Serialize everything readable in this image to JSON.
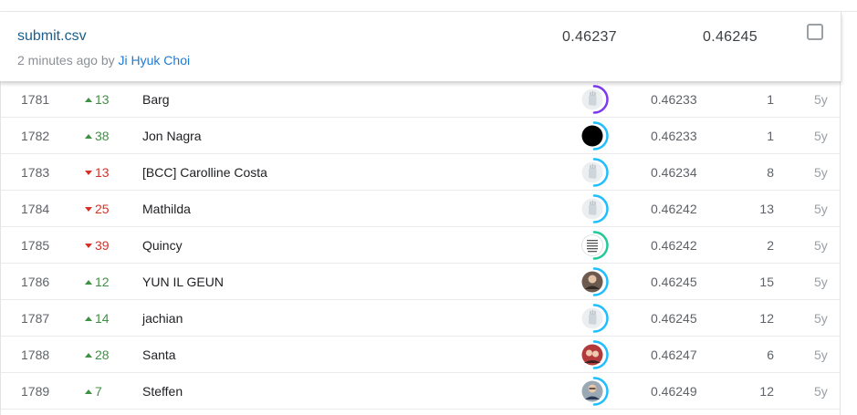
{
  "submission": {
    "file_name": "submit.csv",
    "time_ago": "2 minutes ago by ",
    "user": "Ji Hyuk Choi",
    "private_score": "0.46237",
    "public_score": "0.46245",
    "selected": false
  },
  "leaderboard": {
    "rows": [
      {
        "rank": "1781",
        "direction": "up",
        "change": "13",
        "team": "Barg",
        "avatar": "hand-icon",
        "tier_color": "#7c3aed",
        "score": "0.46233",
        "entries": "1",
        "last": "5y"
      },
      {
        "rank": "1782",
        "direction": "up",
        "change": "38",
        "team": "Jon Nagra",
        "avatar": "black-avatar",
        "tier_color": "#20beff",
        "score": "0.46233",
        "entries": "1",
        "last": "5y"
      },
      {
        "rank": "1783",
        "direction": "down",
        "change": "13",
        "team": "[BCC] Carolline Costa",
        "avatar": "hand-icon",
        "tier_color": "#20beff",
        "score": "0.46234",
        "entries": "8",
        "last": "5y"
      },
      {
        "rank": "1784",
        "direction": "down",
        "change": "25",
        "team": "Mathilda",
        "avatar": "hand-icon",
        "tier_color": "#20beff",
        "score": "0.46242",
        "entries": "13",
        "last": "5y"
      },
      {
        "rank": "1785",
        "direction": "down",
        "change": "39",
        "team": "Quincy",
        "avatar": "keep-calm-icon",
        "tier_color": "#20c997",
        "score": "0.46242",
        "entries": "2",
        "last": "5y"
      },
      {
        "rank": "1786",
        "direction": "up",
        "change": "12",
        "team": "YUN IL GEUN",
        "avatar": "photo-avatar",
        "tier_color": "#20beff",
        "score": "0.46245",
        "entries": "15",
        "last": "5y"
      },
      {
        "rank": "1787",
        "direction": "up",
        "change": "14",
        "team": "jachian",
        "avatar": "hand-icon",
        "tier_color": "#20beff",
        "score": "0.46245",
        "entries": "12",
        "last": "5y"
      },
      {
        "rank": "1788",
        "direction": "up",
        "change": "28",
        "team": "Santa",
        "avatar": "photo-avatar-couple",
        "tier_color": "#20beff",
        "score": "0.46247",
        "entries": "6",
        "last": "5y"
      },
      {
        "rank": "1789",
        "direction": "up",
        "change": "7",
        "team": "Steffen",
        "avatar": "photo-avatar-man",
        "tier_color": "#20beff",
        "score": "0.46249",
        "entries": "12",
        "last": "5y"
      }
    ]
  }
}
